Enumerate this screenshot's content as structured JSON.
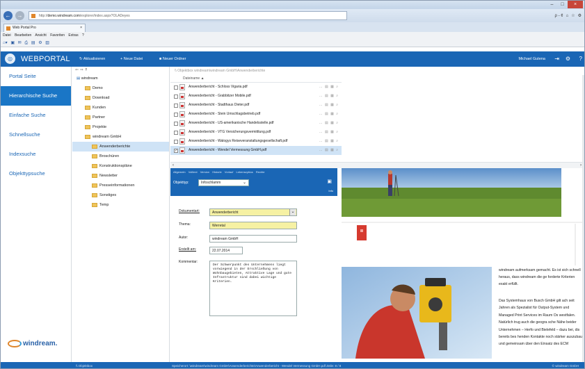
{
  "browser": {
    "url_prefix": "http://",
    "url_domain": "demo.windream.com",
    "url_path": "/explorer/index.aspx?OLADeyes",
    "search_placeholder": "ρ - ¢",
    "tab_title": "Web Portal Pro",
    "tab_close": "×",
    "menu": [
      "Datei",
      "Bearbeiten",
      "Ansicht",
      "Favoriten",
      "Extras",
      "?"
    ]
  },
  "app": {
    "brand": "WEBPORTAL",
    "toolbar": [
      "Aktualisieren",
      "Neue Datei",
      "Neuer Ordner"
    ],
    "user": "Michael Gutena",
    "accent": "#1a66b5"
  },
  "sidebar": {
    "items": [
      {
        "label": "Portal Seite"
      },
      {
        "label": "Hierarchische Suche"
      },
      {
        "label": "Einfache Suche"
      },
      {
        "label": "Schnellsuche"
      },
      {
        "label": "Indexsuche"
      },
      {
        "label": "Objekttypsuche"
      }
    ],
    "logo_text": "windream."
  },
  "tree": {
    "root": "windream",
    "nodes": [
      {
        "label": "Demo"
      },
      {
        "label": "Download"
      },
      {
        "label": "Kunden"
      },
      {
        "label": "Partner"
      },
      {
        "label": "Projekte"
      },
      {
        "label": "windream GmbH"
      },
      {
        "label": "Anwenderberichte"
      },
      {
        "label": "Broschüren"
      },
      {
        "label": "Konstruktionspläne"
      },
      {
        "label": "Newsletter"
      },
      {
        "label": "Presseinformationen"
      },
      {
        "label": "Sonstiges"
      },
      {
        "label": "Temp"
      }
    ]
  },
  "list": {
    "path": "\\\\ Objektbox   windream\\windream GmbH\\Anwenderberichte",
    "header": "Dateiname",
    "rows": [
      {
        "name": "Anwenderbericht - Schloss Vigaria.pdf"
      },
      {
        "name": "Anwenderbericht - Grabbitzer Mobile.pdf"
      },
      {
        "name": "Anwenderbericht - Stadthaus Dieter.pdf"
      },
      {
        "name": "Anwenderbericht - Stein Umschlagsbetrieb.pdf"
      },
      {
        "name": "Anwenderbericht - US-amerikanische Handelsstelle.pdf"
      },
      {
        "name": "Anwenderbericht - VTG Versicherungsvermittlung.pdf"
      },
      {
        "name": "Anwenderbericht - Walogys Reiseveranstaltungsgesellschaft.pdf"
      },
      {
        "name": "Anwenderbericht - Wendel Vermessung GmbH.pdf"
      }
    ]
  },
  "properties": {
    "tabs": [
      "Allgemein",
      "Volltext",
      "Version",
      "Historie",
      "Vorlauf",
      "Lebenszyklus",
      "Rechte"
    ],
    "objtype_label": "Objekttyp:",
    "objtype_value": "Infoschlamm",
    "info_link": "Info",
    "fields": [
      {
        "label": "Dokumentart:",
        "value": "Anwenderbericht"
      },
      {
        "label": "Thema:",
        "value": "Werretal"
      },
      {
        "label": "Autor:",
        "value": "windream GmbH"
      },
      {
        "label": "Erstellt am:",
        "value": "22.07.2014"
      }
    ],
    "remarks_label": "Kommentar:",
    "remarks_text": "Der Schwerpunkt des Unternehmens liegt vorwiegend in der Erschließung von Wohnbaugebieten, Attraktive Lage und gute Infrastruktur sind dabei wichtige Kriterien."
  },
  "preview": {
    "para1": "windream aufmerksam gemacht. Es ist sich schnell heraus, dass windream die ge forderte Kriterien exakt erfüllt.",
    "para2": "Das Systemhaus von Busch GmbH gilt ach seit Jahren als Spezialist für Output-System und Managed Print Services im Raum Os westfalen. Natürlich trug auch die geogra sche Nähe beider Unternehmen – Herfo und Bielefeld – dazu bei, dis bereits bes henden Kontakte noch stärker auszubau und gemeinsam über den Einsatz des ECM"
  },
  "statusbar": {
    "left": "\\\\ Objektbox",
    "path": "Speicherort:   \\windream\\windream GmbH\\Anwenderberichte\\Anwenderbericht - Wendel Vermessung GmbH.pdf   Zeile: 8 / 8",
    "right": "© windream GmbH"
  }
}
